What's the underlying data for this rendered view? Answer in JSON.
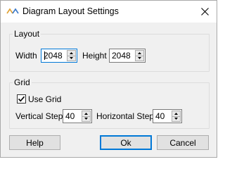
{
  "window": {
    "title": "Diagram Layout Settings",
    "close_glyph": "✕",
    "accent": "#0078d7"
  },
  "layout_group": {
    "title": "Layout",
    "width_label": "Width",
    "width_value": "2048",
    "height_label": "Height",
    "height_value": "2048"
  },
  "grid_group": {
    "title": "Grid",
    "use_grid_label": "Use Grid",
    "use_grid_checked": true,
    "vertical_step_label": "Vertical Step",
    "vertical_step_value": "40",
    "horizontal_step_label": "Horizontal Step",
    "horizontal_step_value": "40"
  },
  "buttons": {
    "help": "Help",
    "ok": "Ok",
    "cancel": "Cancel"
  },
  "icons": {
    "app": "diagram-layout-icon",
    "close": "close-icon",
    "spin_up": "spin-up-icon",
    "spin_down": "spin-down-icon",
    "check": "checkmark-icon"
  }
}
